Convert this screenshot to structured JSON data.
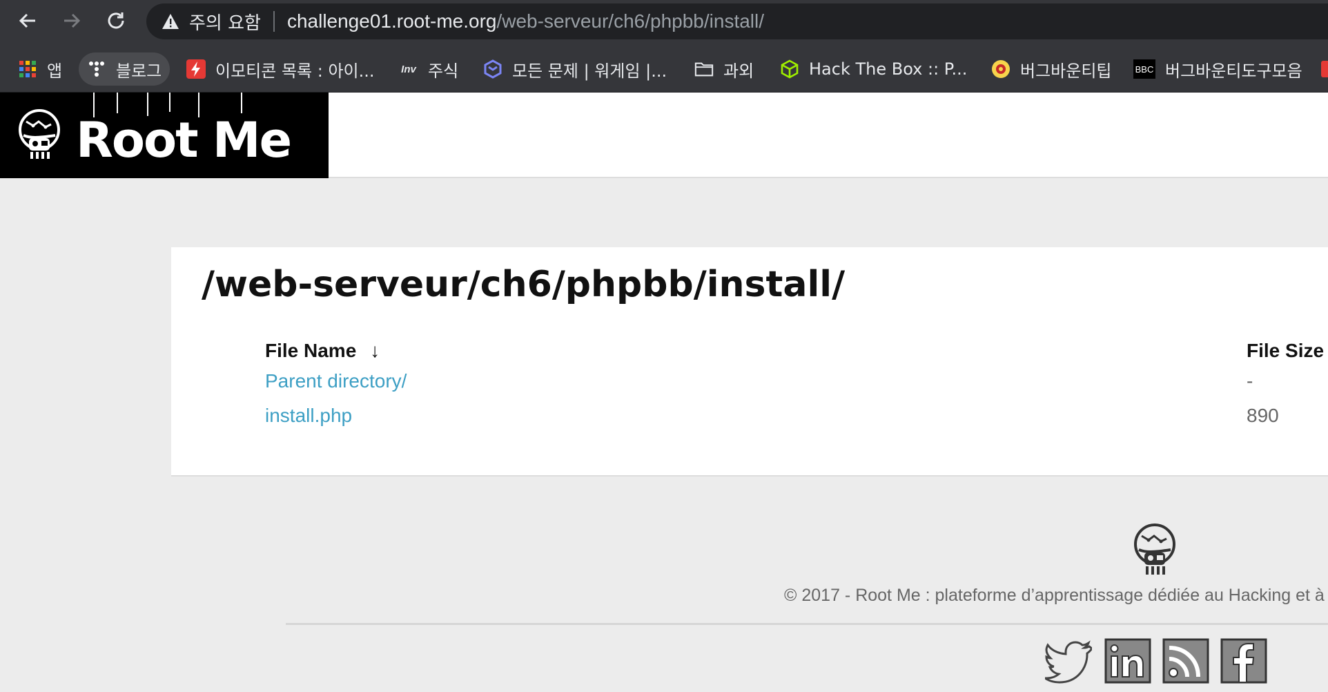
{
  "browser": {
    "security_warning": "주의 요함",
    "url_host": "challenge01.root-me.org",
    "url_path": "/web-serveur/ch6/phpbb/install/"
  },
  "bookmarks": [
    {
      "label": "앱",
      "icon": "apps-grid-icon"
    },
    {
      "label": "블로그",
      "icon": "tistory-icon"
    },
    {
      "label": "이모티콘 목록 : 아이...",
      "icon": "lightning-icon"
    },
    {
      "label": "주식",
      "icon": "inv-icon",
      "icon_text": "Inv"
    },
    {
      "label": "모든 문제 | 워게임 |...",
      "icon": "dreamhack-icon"
    },
    {
      "label": "과외",
      "icon": "folder-icon"
    },
    {
      "label": "Hack The Box :: P...",
      "icon": "htb-cube-icon"
    },
    {
      "label": "버그바운티팁",
      "icon": "bug-bounty-icon"
    },
    {
      "label": "버그바운티도구모음",
      "icon": "bbc-icon",
      "icon_text": "BBC"
    }
  ],
  "site": {
    "logo_text": "Root Me"
  },
  "listing": {
    "title": "/web-serveur/ch6/phpbb/install/",
    "col_name": "File Name",
    "sort_indicator": "↓",
    "col_size": "File Size",
    "rows": [
      {
        "name": "Parent directory/",
        "size": "-"
      },
      {
        "name": "install.php",
        "size": "890"
      }
    ]
  },
  "footer": {
    "copyright": "© 2017 - Root Me : plateforme d’apprentissage dédiée au Hacking et à l"
  },
  "colors": {
    "link": "#3d9fc4",
    "chrome_bg": "#35363a",
    "page_bg": "#ececec"
  }
}
